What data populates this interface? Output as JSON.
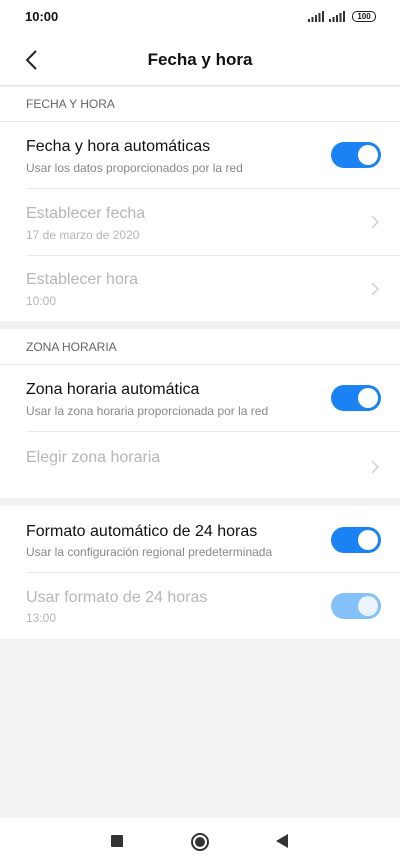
{
  "status_bar": {
    "time": "10:00",
    "battery": "100"
  },
  "header": {
    "title": "Fecha y hora"
  },
  "sections": {
    "date_time": {
      "header": "FECHA Y HORA",
      "auto": {
        "title": "Fecha y hora automáticas",
        "subtitle": "Usar los datos proporcionados por la red",
        "on": true
      },
      "set_date": {
        "title": "Establecer fecha",
        "subtitle": "17 de marzo de 2020"
      },
      "set_time": {
        "title": "Establecer hora",
        "subtitle": "10:00"
      }
    },
    "timezone": {
      "header": "ZONA HORARIA",
      "auto": {
        "title": "Zona horaria automática",
        "subtitle": "Usar la zona horaria proporcionada por la red",
        "on": true
      },
      "choose": {
        "title": "Elegir zona horaria"
      }
    },
    "format": {
      "auto24": {
        "title": "Formato automático de 24 horas",
        "subtitle": "Usar la configuración regional predeterminada",
        "on": true
      },
      "use24": {
        "title": "Usar formato de 24 horas",
        "subtitle": "13:00",
        "on": true,
        "enabled": false
      }
    }
  },
  "icons": [
    "back-arrow-icon",
    "chevron-right-icon",
    "signal-icon",
    "battery-icon",
    "recents-square-icon",
    "home-circle-icon",
    "back-triangle-icon"
  ],
  "colors": {
    "accent": "#1a82f3",
    "accent_disabled": "#84c1f9",
    "background": "#f2f2f2"
  }
}
